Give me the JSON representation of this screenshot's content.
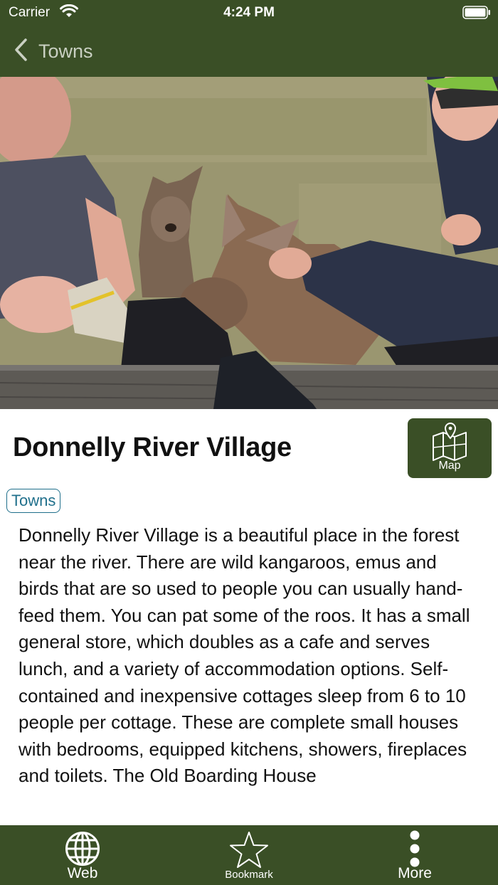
{
  "status_bar": {
    "carrier": "Carrier",
    "time": "4:24 PM"
  },
  "nav": {
    "back_label": "Towns"
  },
  "place": {
    "title": "Donnelly River Village",
    "category": "Towns",
    "description": "Donnelly River Village is a beautiful place in the forest near the river. There are wild kangaroos, emus and birds that are so used to people you can usually hand-feed them. You can pat some of the roos. It has a small general store, which doubles as a cafe and serves lunch, and a variety of accommodation options. Self-contained and inexpensive cottages sleep from 6 to 10 people per cottage. These are complete small houses with bedrooms, equipped kitchens, showers, fireplaces and toilets. The Old Boarding House"
  },
  "map_button": {
    "label": "Map"
  },
  "tabs": [
    {
      "label": "Web",
      "icon": "globe-icon"
    },
    {
      "label": "Bookmark",
      "icon": "star-icon"
    },
    {
      "label": "More",
      "icon": "more-vertical-icon"
    }
  ],
  "colors": {
    "bar_green": "#3a4f26",
    "tag_blue": "#1f6f8b",
    "back_label_grey": "#c9d0c2"
  }
}
